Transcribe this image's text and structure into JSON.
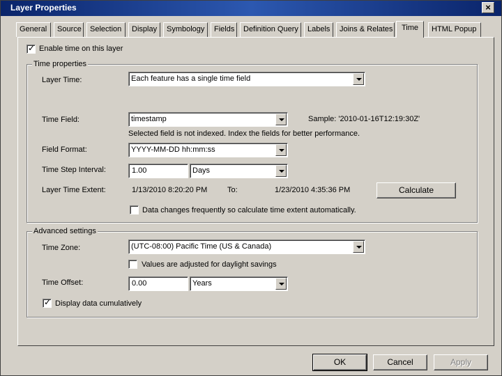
{
  "window": {
    "title": "Layer Properties",
    "close_glyph": "×"
  },
  "tabs": [
    {
      "label": "General"
    },
    {
      "label": "Source"
    },
    {
      "label": "Selection"
    },
    {
      "label": "Display"
    },
    {
      "label": "Symbology"
    },
    {
      "label": "Fields"
    },
    {
      "label": "Definition Query"
    },
    {
      "label": "Labels"
    },
    {
      "label": "Joins & Relates"
    },
    {
      "label": "Time"
    },
    {
      "label": "HTML Popup"
    }
  ],
  "active_tab": "Time",
  "enable_time": {
    "label": "Enable time on this layer",
    "checked": true,
    "mark": "✓"
  },
  "time_properties": {
    "title": "Time properties",
    "layer_time_label": "Layer Time:",
    "layer_time_value": "Each feature has a single time field",
    "time_field_label": "Time Field:",
    "time_field_value": "timestamp",
    "sample": "Sample: '2010-01-16T12:19:30Z'",
    "index_warning": "Selected field is not indexed. Index the fields for better performance.",
    "field_format_label": "Field Format:",
    "field_format_value": "YYYY-MM-DD hh:mm:ss",
    "step_label": "Time Step Interval:",
    "step_value": "1.00",
    "step_unit": "Days",
    "extent_label": "Layer Time Extent:",
    "extent_start": "1/13/2010 8:20:20 PM",
    "extent_to": "To:",
    "extent_end": "1/23/2010 4:35:36 PM",
    "calculate_label": "Calculate",
    "auto_calc": {
      "label": "Data changes frequently so calculate time extent automatically.",
      "checked": false
    }
  },
  "advanced": {
    "title": "Advanced settings",
    "timezone_label": "Time Zone:",
    "timezone_value": "(UTC-08:00) Pacific Time (US & Canada)",
    "dst": {
      "label": "Values are adjusted for daylight savings",
      "checked": false
    },
    "offset_label": "Time Offset:",
    "offset_value": "0.00",
    "offset_unit": "Years",
    "cumulative": {
      "label": "Display data cumulatively",
      "checked": true,
      "mark": "✓"
    }
  },
  "buttons": {
    "ok": "OK",
    "cancel": "Cancel",
    "apply": "Apply"
  }
}
